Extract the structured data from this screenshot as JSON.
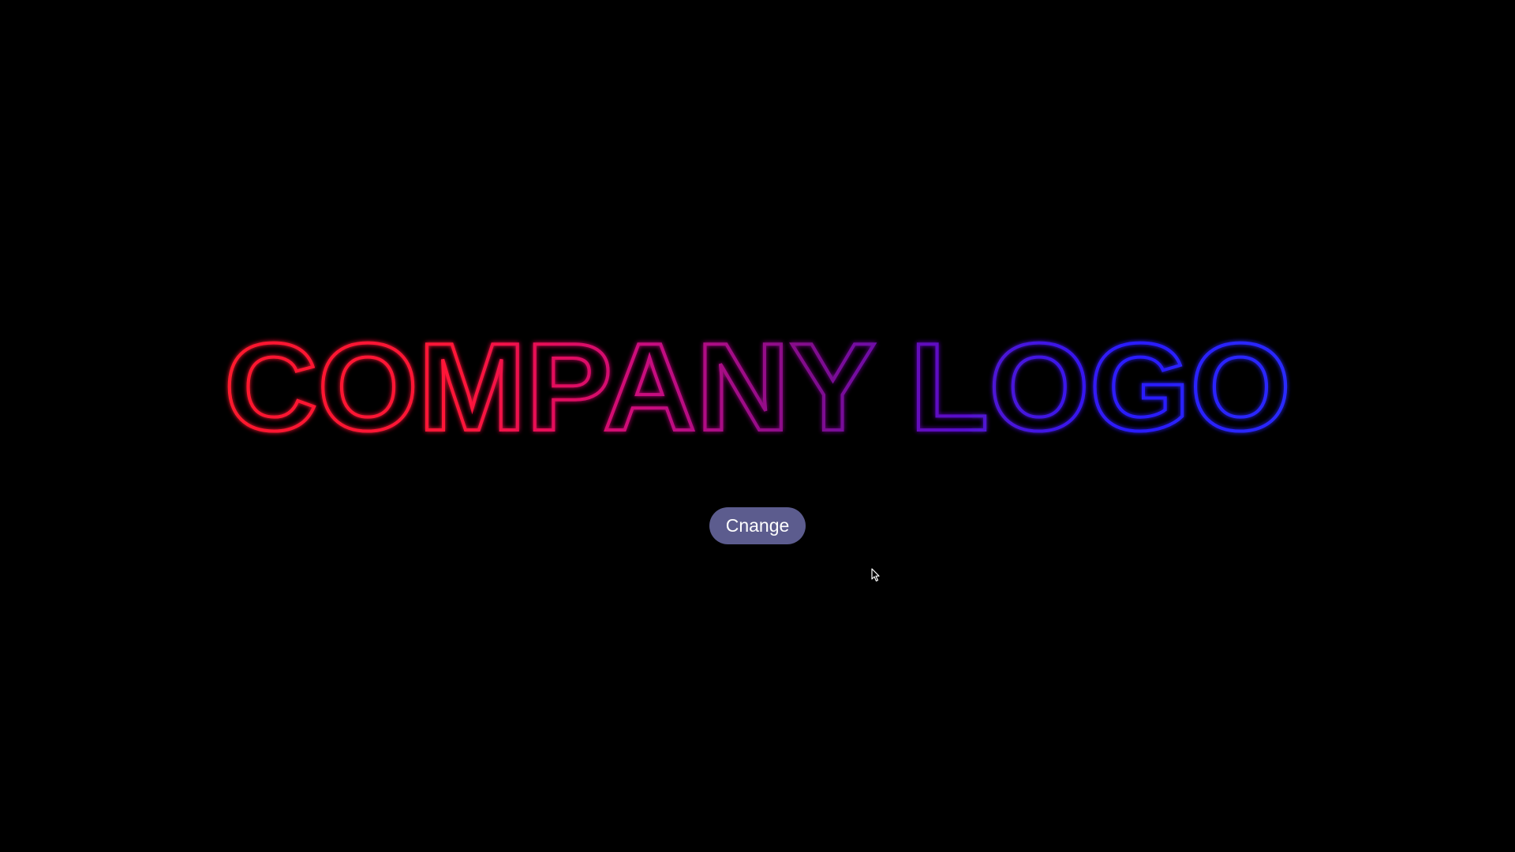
{
  "logo": {
    "text": "COMPANY LOGO",
    "colors": {
      "start": "#ff1a2e",
      "middle": "#c0108f",
      "end": "#2a1cff",
      "highlight": "#ff2bf0"
    }
  },
  "controls": {
    "change_label": "Cnange",
    "button_color": "#5c5c8e"
  },
  "pointer": {
    "icon": "mouse-pointer-icon"
  }
}
